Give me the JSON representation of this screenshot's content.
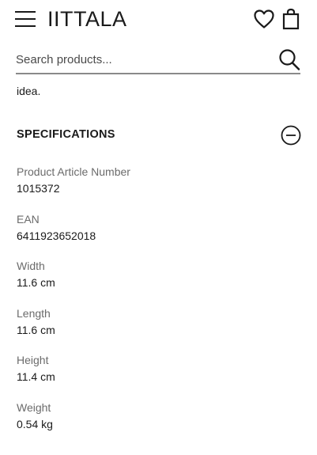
{
  "header": {
    "logo": "IITTALA",
    "icons": {
      "menu": "hamburger-menu-icon",
      "wishlist": "heart-icon",
      "bag": "shopping-bag-icon"
    }
  },
  "search": {
    "placeholder": "Search products...",
    "icon": "search-icon"
  },
  "description_tail": "idea.",
  "specifications": {
    "title": "SPECIFICATIONS",
    "toggle_icon": "minus-circle-icon",
    "items": [
      {
        "label": "Product Article Number",
        "value": "1015372"
      },
      {
        "label": "EAN",
        "value": "6411923652018"
      },
      {
        "label": "Width",
        "value": "11.6 cm"
      },
      {
        "label": "Length",
        "value": "11.6 cm"
      },
      {
        "label": "Height",
        "value": "11.4 cm"
      },
      {
        "label": "Weight",
        "value": "0.54 kg"
      }
    ]
  }
}
